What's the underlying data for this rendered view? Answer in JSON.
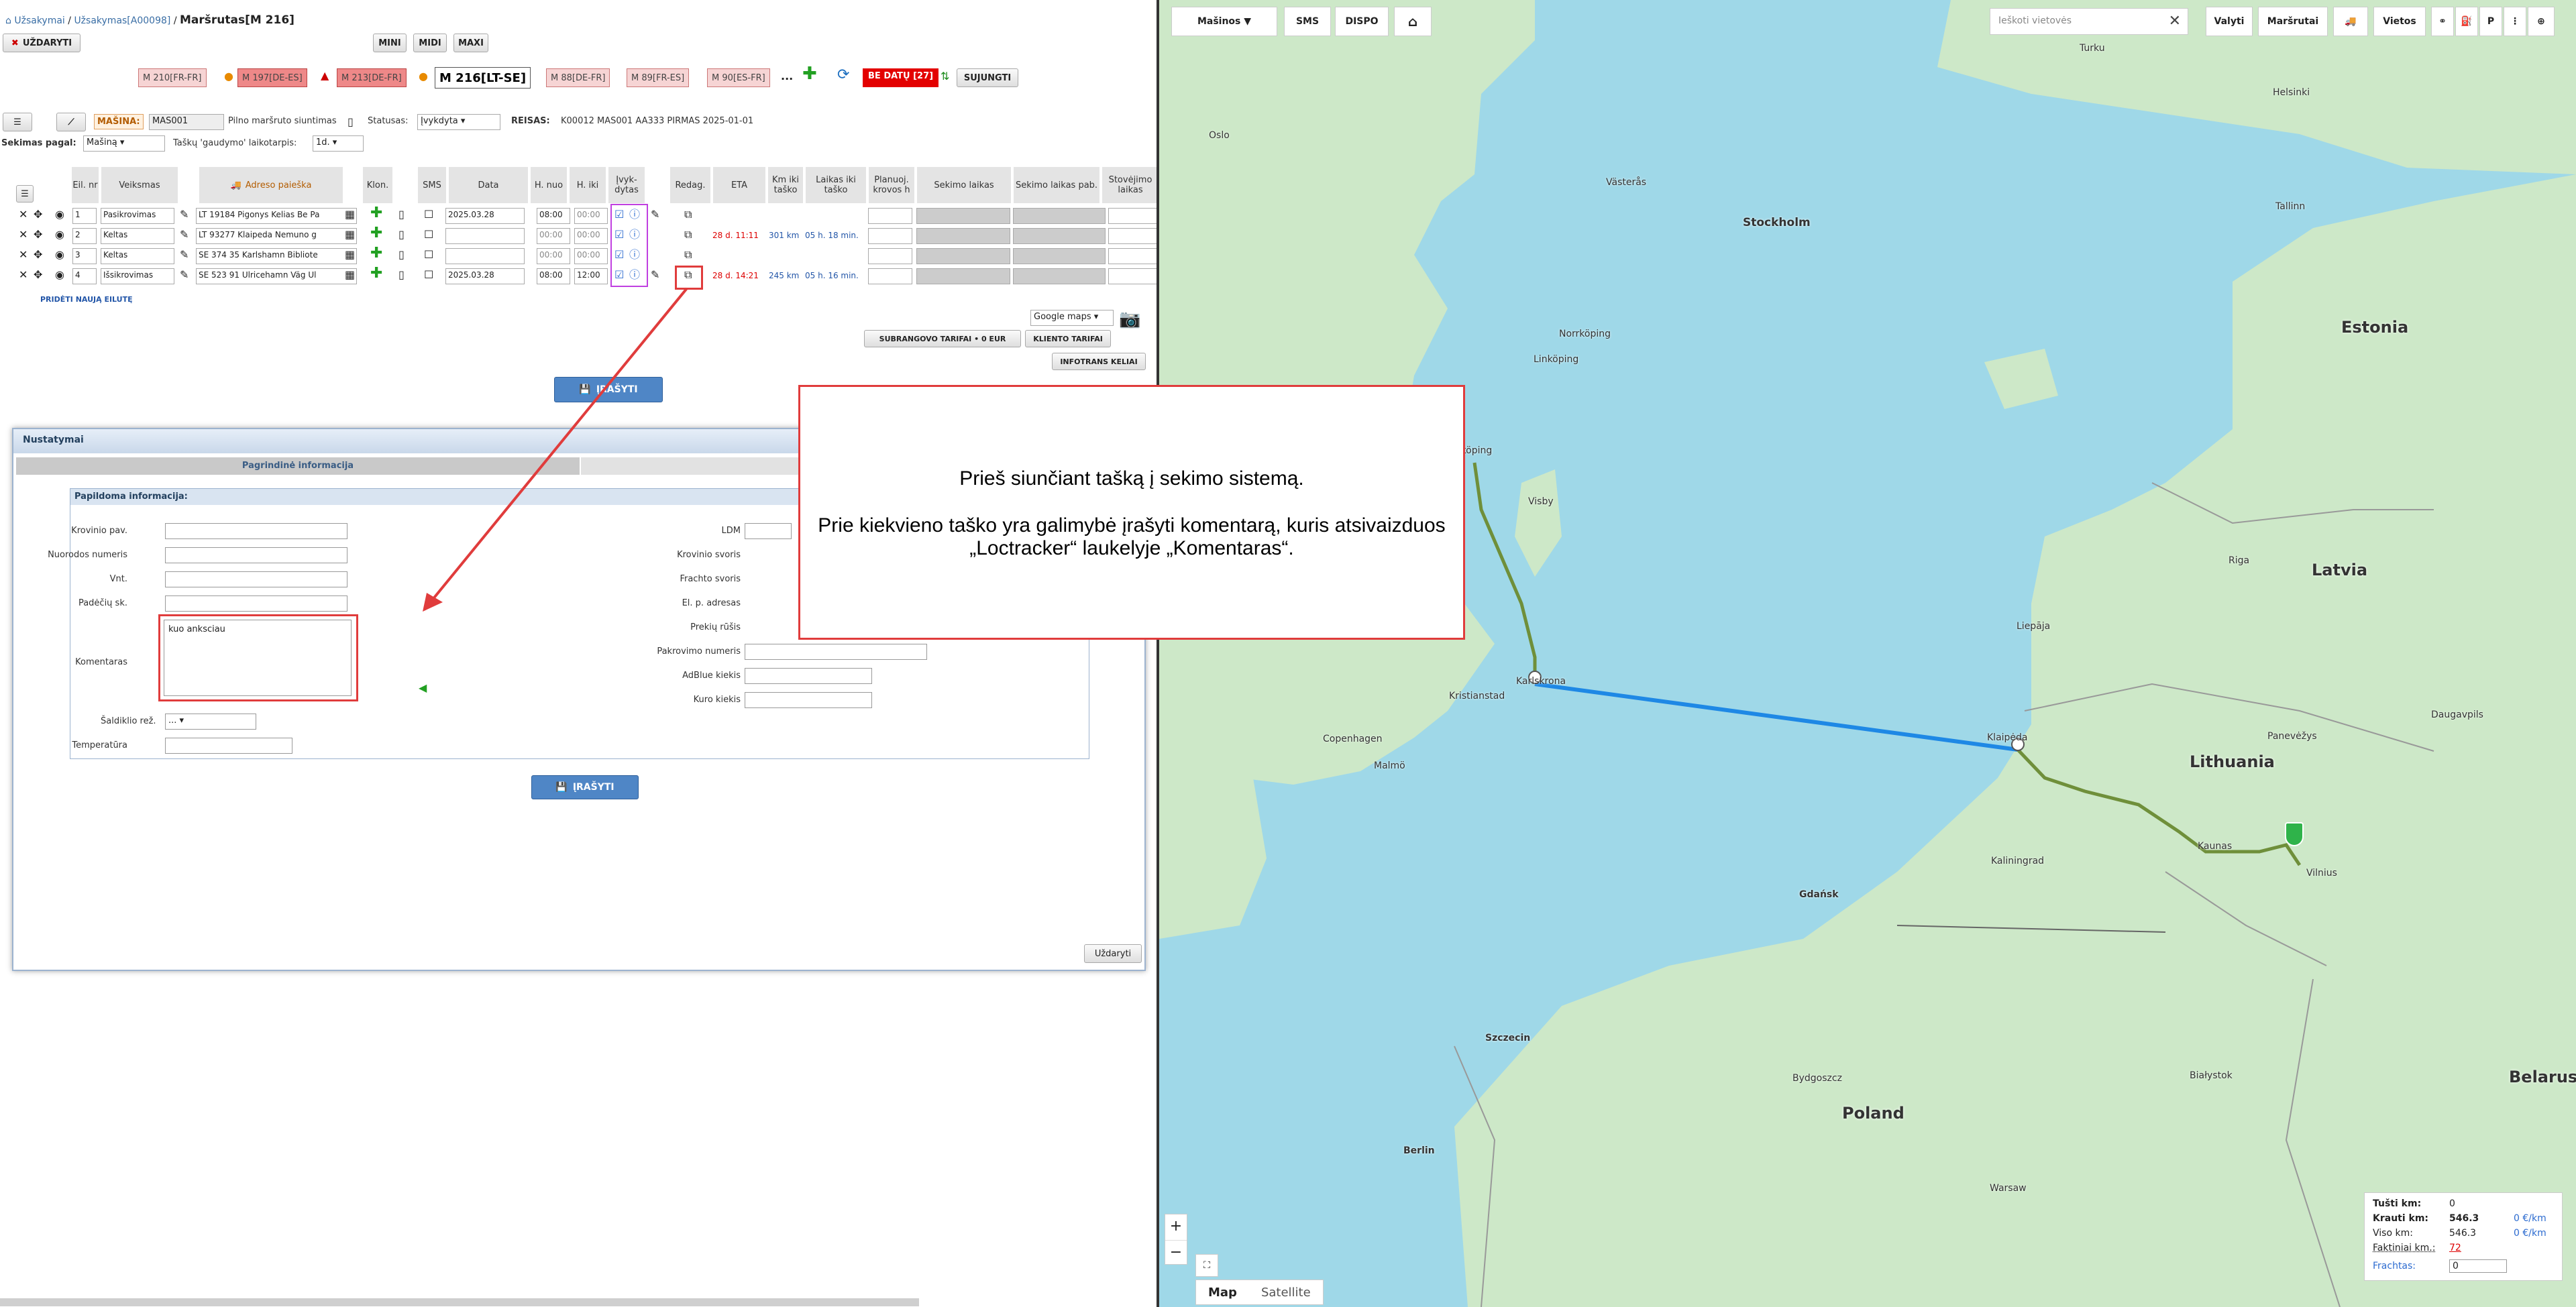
{
  "breadcrumb": {
    "orders": "Užsakymai",
    "order": "Užsakymas[A00098]",
    "sep": "/",
    "current": "Maršrutas[M 216]"
  },
  "close_label": "UŽDARYTI",
  "view_buttons": [
    "MINI",
    "MIDI",
    "MAXI"
  ],
  "route_pills": [
    "M 210[FR-FR]",
    "M 197[DE-ES]",
    "M 213[DE-FR]",
    "M 216[LT-SE]",
    "M 88[DE-FR]",
    "M 89[FR-ES]",
    "M 90[ES-FR]"
  ],
  "ellipsis": "...",
  "be_datu": "BE DATŲ [27]",
  "join_label": "SUJUNGTI",
  "machine_label": "MAŠINA:",
  "machine_value": "MAS001",
  "full_route_label": "Pilno maršruto siuntimas",
  "status_label": "Statusas:",
  "status_value": "Įvykdyta",
  "trip_label": "REISAS:",
  "trip_value": "K00012 MAS001 AA333 PIRMAS 2025-01-01",
  "tracking_label": "Sekimas pagal:",
  "tracking_value": "Mašiną",
  "catch_label": "Taškų 'gaudymo' laikotarpis:",
  "catch_value": "1d.",
  "table_headers": [
    "Eil. nr",
    "Veiksmas",
    "Adreso paieška",
    "Klon.",
    "SMS",
    "Data",
    "H. nuo",
    "H. iki",
    "Įvyk-dytas",
    "Redag.",
    "ETA",
    "Km iki taško",
    "Laikas iki taško",
    "Planuoj. krovos h",
    "Sekimo laikas",
    "Sekimo laikas pab.",
    "Stovėjimo laikas"
  ],
  "rows": [
    {
      "nr": "1",
      "action": "Pasikrovimas",
      "address": "LT 19184 Pigonys Kelias Be Pa",
      "date": "2025.03.28",
      "from": "08:00",
      "to": "00:00",
      "eta": "",
      "km": "",
      "time": ""
    },
    {
      "nr": "2",
      "action": "Keltas",
      "address": "LT 93277 Klaipeda Nemuno g",
      "date": "",
      "from": "00:00",
      "to": "00:00",
      "eta": "28 d. 11:11",
      "km": "301 km",
      "time": "05 h. 18 min."
    },
    {
      "nr": "3",
      "action": "Keltas",
      "address": "SE 374 35 Karlshamn Bibliote",
      "date": "",
      "from": "00:00",
      "to": "00:00",
      "eta": "",
      "km": "",
      "time": ""
    },
    {
      "nr": "4",
      "action": "Išsikrovimas",
      "address": "SE 523 91 Ulricehamn Väg Ul",
      "date": "2025.03.28",
      "from": "08:00",
      "to": "12:00",
      "eta": "28 d. 14:21",
      "km": "245 km",
      "time": "05 h. 16 min."
    }
  ],
  "add_row": "PRIDĖTI NAUJĄ EILUTĘ",
  "save_label": "ĮRAŠYTI",
  "map_select": "Google maps",
  "subcontract_btn": "SUBRANGOVO TARIFAI • 0 EUR",
  "client_btn": "KLIENTO TARIFAI",
  "infotrans_btn": "INFOTRANS KELIAI",
  "modal": {
    "title": "Nustatymai",
    "tab_main": "Pagrindinė informacija",
    "section": "Papildoma informacija:",
    "left_labels": [
      "Krovinio pav.",
      "Nuorodos numeris",
      "Vnt.",
      "Padėčių sk.",
      "Komentaras"
    ],
    "comment_value": "kuo anksciau",
    "fridge_label": "Šaldiklio rež.",
    "fridge_value": "...",
    "temp_label": "Temperatūra",
    "right_labels": [
      "LDM",
      "Krovinio svoris",
      "Frachto svoris",
      "El. p. adresas",
      "Prekių rūšis",
      "Pakrovimo numeris",
      "AdBlue kiekis",
      "Kuro kiekis"
    ],
    "close": "Uždaryti"
  },
  "callout": {
    "line1": "Prieš siunčiant tašką į sekimo sistemą.",
    "line2": "Prie kiekvieno taško yra galimybė įrašyti komentarą, kuris atsivaizduos",
    "line3": "„Loctracker“ laukelyje „Komentaras“."
  },
  "map": {
    "toolbar": [
      "Mašinos ▼",
      "SMS",
      "DISPO"
    ],
    "search_placeholder": "Ieškoti vietovės",
    "right_buttons": [
      "Valyti",
      "Maršrutai",
      "Vietos"
    ],
    "map_tab": "Map",
    "satellite_tab": "Satellite",
    "zoom_in": "+",
    "zoom_out": "−",
    "countries": [
      "Estonia",
      "Latvia",
      "Lithuania",
      "Poland",
      "Belarus"
    ],
    "cities": [
      "Turku",
      "Helsinki",
      "Oslo",
      "Stockholm",
      "Tallinn",
      "Västerås",
      "Norrköping",
      "Linköping",
      "Jönköping",
      "Karlskrona",
      "Kristianstad",
      "Copenhagen",
      "Malmö",
      "Klaipėda",
      "Riga",
      "Liepāja",
      "Kaunas",
      "Vilnius",
      "Panevėžys",
      "Gdańsk",
      "Szczecin",
      "Berlin",
      "Bydgoszcz",
      "Warsaw",
      "Białystok",
      "Kaliningrad",
      "Visby",
      "Daugavpils"
    ],
    "stats": {
      "empty_km_label": "Tušti km:",
      "empty_km": "0",
      "loaded_km_label": "Krauti km:",
      "loaded_km": "546.3",
      "loaded_rate": "0 €/km",
      "total_km_label": "Viso km:",
      "total_km": "546.3",
      "total_rate": "0 €/km",
      "actual_km_label": "Faktiniai km.:",
      "actual_km": "72",
      "freight_label": "Frachtas:",
      "freight": "0"
    }
  }
}
